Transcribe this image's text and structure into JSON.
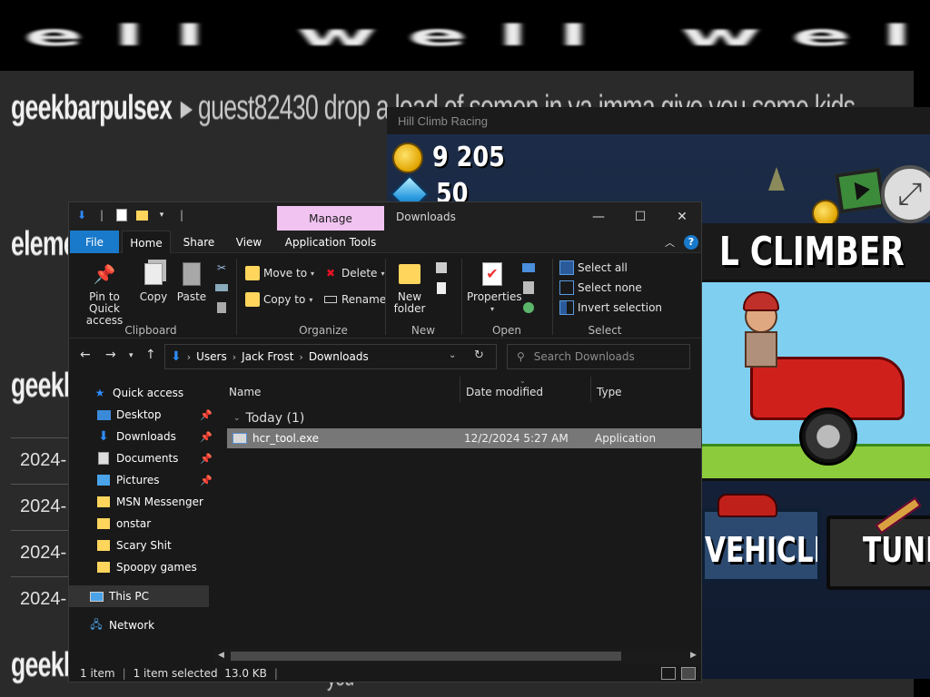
{
  "background": {
    "banner_text": "well well well",
    "chat_lines": [
      {
        "user": "geekbarpulsex",
        "message": "guest82430 drop a load of semen in ya imma give you some kids"
      },
      {
        "user": "elemel",
        "message": ""
      },
      {
        "user": "geekba",
        "message": ""
      },
      {
        "user": "geekba",
        "message": ""
      }
    ],
    "timestamps": [
      "2024-",
      "2024-",
      "2024-",
      "2024-",
      "2024-"
    ],
    "partial_message": "you"
  },
  "game": {
    "window_title": "Hill Climb Racing",
    "coins": "9 205",
    "gems": "50",
    "vehicle_title": "L CLIMBER",
    "vehicle_button": "VEHICLE",
    "tune_button": "TUNE"
  },
  "explorer": {
    "window_title": "Downloads",
    "manage_tab": "Manage",
    "tabs": {
      "file": "File",
      "home": "Home",
      "share": "Share",
      "view": "View",
      "app_tools": "Application Tools"
    },
    "ribbon": {
      "clipboard": {
        "pin": "Pin to Quick access",
        "copy": "Copy",
        "paste": "Paste",
        "label": "Clipboard"
      },
      "organize": {
        "move_to": "Move to",
        "copy_to": "Copy to",
        "delete": "Delete",
        "rename": "Rename",
        "label": "Organize"
      },
      "new": {
        "new_folder": "New folder",
        "label": "New"
      },
      "open": {
        "properties": "Properties",
        "label": "Open"
      },
      "select": {
        "select_all": "Select all",
        "select_none": "Select none",
        "invert": "Invert selection",
        "label": "Select"
      }
    },
    "breadcrumb": [
      "Users",
      "Jack Frost",
      "Downloads"
    ],
    "search_placeholder": "Search Downloads",
    "nav": {
      "quick_access": "Quick access",
      "items": [
        {
          "label": "Desktop",
          "pinned": true
        },
        {
          "label": "Downloads",
          "pinned": true
        },
        {
          "label": "Documents",
          "pinned": true
        },
        {
          "label": "Pictures",
          "pinned": true
        },
        {
          "label": "MSN Messenger",
          "pinned": false
        },
        {
          "label": "onstar",
          "pinned": false
        },
        {
          "label": "Scary Shit",
          "pinned": false
        },
        {
          "label": "Spoopy games",
          "pinned": false
        }
      ],
      "this_pc": "This PC",
      "network": "Network"
    },
    "columns": {
      "name": "Name",
      "date_modified": "Date modified",
      "type": "Type"
    },
    "group_header": "Today (1)",
    "files": [
      {
        "name": "hcr_tool.exe",
        "date": "12/2/2024 5:27 AM",
        "type": "Application"
      }
    ],
    "status": {
      "items": "1 item",
      "selected": "1 item selected  13.0 KB"
    }
  },
  "colors": {
    "accent": "#1979ca",
    "manage_tab": "#f1c3f1",
    "selection": "#777777",
    "explorer_bg": "#191919"
  }
}
